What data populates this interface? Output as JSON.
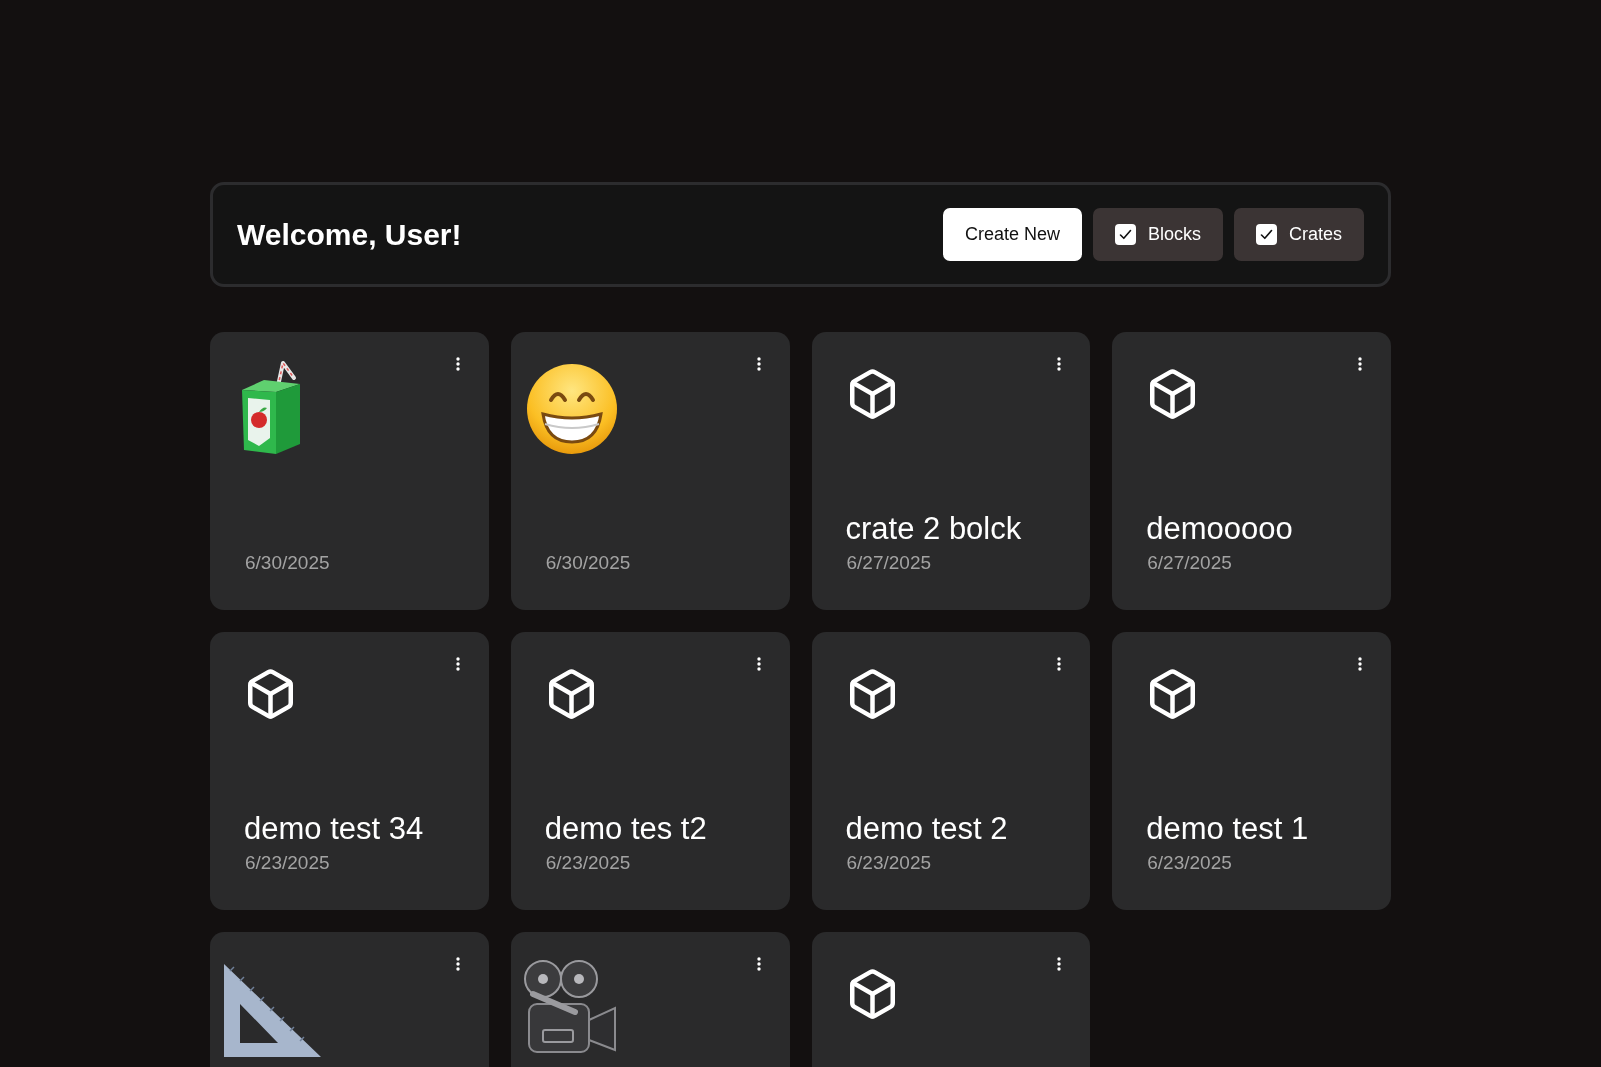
{
  "header": {
    "title": "Welcome, User!",
    "create_button": "Create New",
    "filters": [
      {
        "label": "Blocks",
        "checked": true
      },
      {
        "label": "Crates",
        "checked": true
      }
    ]
  },
  "cards": [
    {
      "kind": "juice-box",
      "date": "6/30/2025"
    },
    {
      "kind": "grinning-face",
      "date": "6/30/2025"
    },
    {
      "kind": "cube",
      "title": "crate 2 bolck",
      "date": "6/27/2025"
    },
    {
      "kind": "cube",
      "title": "demooooo",
      "date": "6/27/2025"
    },
    {
      "kind": "cube",
      "title": "demo test 34",
      "date": "6/23/2025"
    },
    {
      "kind": "cube",
      "title": "demo tes t2",
      "date": "6/23/2025"
    },
    {
      "kind": "cube",
      "title": "demo test 2",
      "date": "6/23/2025"
    },
    {
      "kind": "cube",
      "title": "demo test 1",
      "date": "6/23/2025"
    },
    {
      "kind": "triangle-ruler"
    },
    {
      "kind": "movie-camera"
    },
    {
      "kind": "cube"
    }
  ]
}
